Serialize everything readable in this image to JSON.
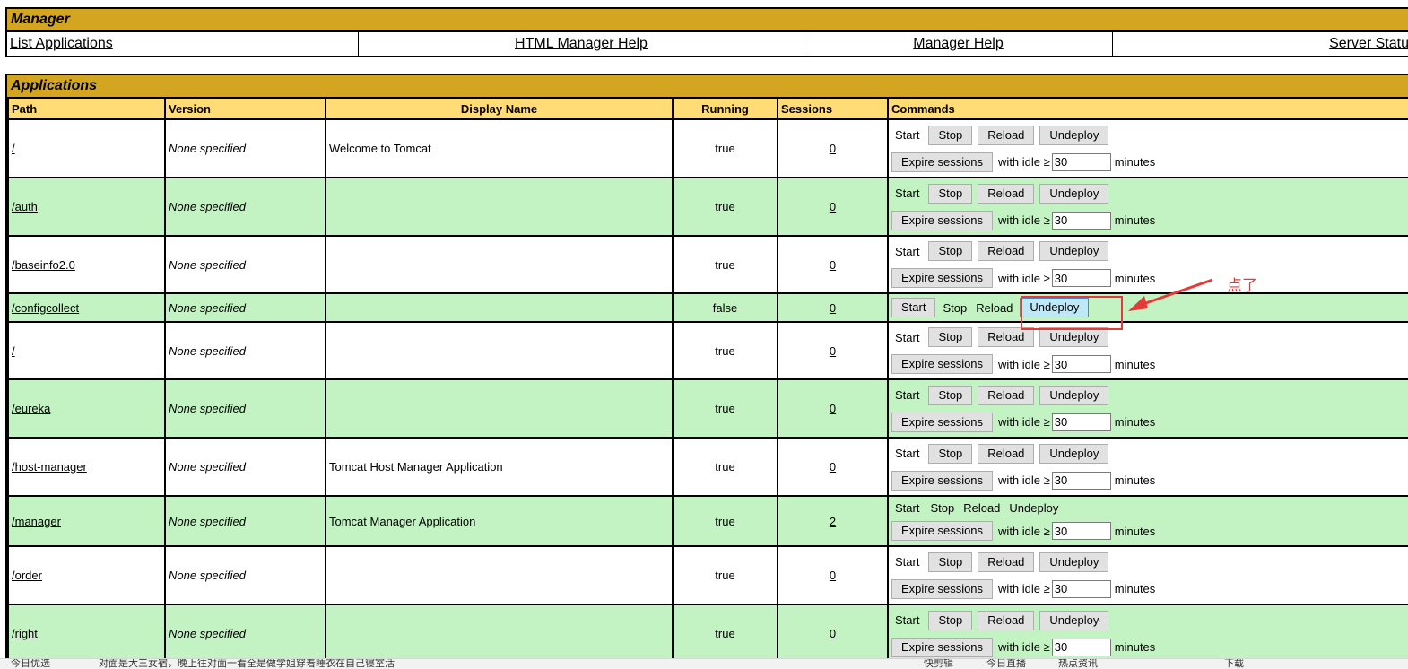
{
  "manager": {
    "title": "Manager",
    "links": [
      "List Applications",
      "HTML Manager Help",
      "Manager Help",
      "Server Status"
    ]
  },
  "applications": {
    "title": "Applications",
    "columns": [
      "Path",
      "Version",
      "Display Name",
      "Running",
      "Sessions",
      "Commands"
    ],
    "rows": [
      {
        "path": "/",
        "version": "None specified",
        "display": "Welcome to Tomcat",
        "running": "true",
        "sessions": "0"
      },
      {
        "path": "/auth",
        "version": "None specified",
        "display": "",
        "running": "true",
        "sessions": "0"
      },
      {
        "path": "/baseinfo2.0",
        "version": "None specified",
        "display": "",
        "running": "true",
        "sessions": "0"
      },
      {
        "path": "/configcollect",
        "version": "None specified",
        "display": "",
        "running": "false",
        "sessions": "0"
      },
      {
        "path": "/",
        "version": "None specified",
        "display": "",
        "running": "true",
        "sessions": "0"
      },
      {
        "path": "/eureka",
        "version": "None specified",
        "display": "",
        "running": "true",
        "sessions": "0"
      },
      {
        "path": "/host-manager",
        "version": "None specified",
        "display": "Tomcat Host Manager Application",
        "running": "true",
        "sessions": "0"
      },
      {
        "path": "/manager",
        "version": "None specified",
        "display": "Tomcat Manager Application",
        "running": "true",
        "sessions": "2"
      },
      {
        "path": "/order",
        "version": "None specified",
        "display": "",
        "running": "true",
        "sessions": "0"
      },
      {
        "path": "/right",
        "version": "None specified",
        "display": "",
        "running": "true",
        "sessions": "0"
      }
    ]
  },
  "commands": {
    "start": "Start",
    "stop": "Stop",
    "reload": "Reload",
    "undeploy": "Undeploy",
    "expire": "Expire sessions",
    "with_idle": "with idle ≥",
    "idle_value": "30",
    "minutes": "minutes"
  },
  "annotation": {
    "text": "点了",
    "color": "#e53a3a"
  },
  "status_bar": {
    "items": [
      "今日优选",
      "对面是大三女宿，晚上往对面一看全是做学姐穿着睡衣在自己寝室活",
      "快剪辑",
      "今日直播",
      "热点资讯",
      "下载"
    ]
  },
  "colors": {
    "header_bar": "#d3a521",
    "column_header": "#ffdc75",
    "row_alt": "#c3f3c3",
    "button": "#e1e1e1",
    "button_active": "#bde8f8"
  }
}
